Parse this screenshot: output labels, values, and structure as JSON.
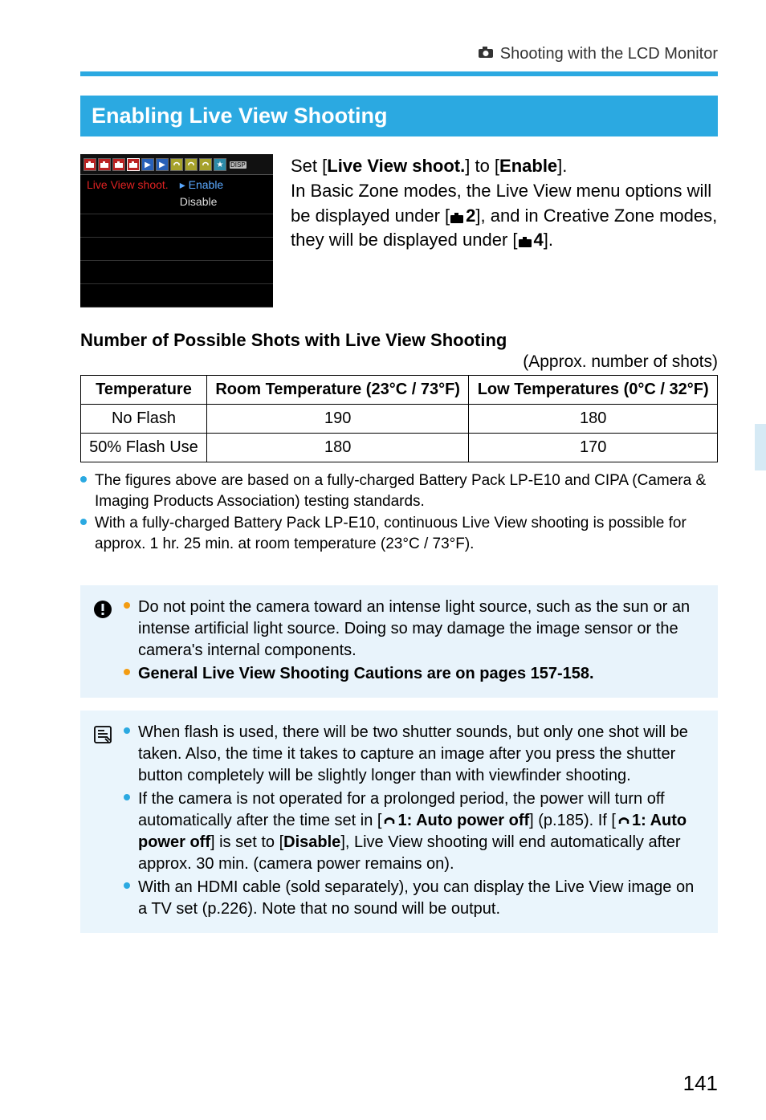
{
  "header": {
    "icon_name": "camera-icon",
    "text": "Shooting with the LCD Monitor"
  },
  "section_heading": "Enabling Live View Shooting",
  "screenshot": {
    "disp_label": "DISP",
    "menu_label": "Live View shoot.",
    "option_selected": "Enable",
    "option_other": "Disable"
  },
  "intro": {
    "l1a": "Set [",
    "l1b": "Live View shoot.",
    "l1c": "] to [",
    "l1d": "Enable",
    "l1e": "].",
    "l2": "In Basic Zone modes, the Live View menu options will be displayed under [",
    "tab2": "2",
    "l2b": "], and in Creative Zone modes, they will be displayed under [",
    "tab4": "4",
    "l2c": "]."
  },
  "subsection_heading": "Number of Possible Shots with Live View Shooting",
  "approx_note": "(Approx. number of shots)",
  "table": {
    "head": [
      "Temperature",
      "Room Temperature (23°C / 73°F)",
      "Low Temperatures (0°C / 32°F)"
    ],
    "rows": [
      [
        "No Flash",
        "190",
        "180"
      ],
      [
        "50% Flash Use",
        "180",
        "170"
      ]
    ]
  },
  "bullets_main": [
    "The figures above are based on a fully-charged Battery Pack LP-E10 and CIPA (Camera & Imaging Products Association) testing standards.",
    "With a fully-charged Battery Pack LP-E10, continuous Live View shooting is possible for approx. 1 hr. 25 min. at room temperature (23°C / 73°F)."
  ],
  "alert": {
    "bullets": [
      "Do not point the camera toward an intense light source, such as the sun or an intense artificial light source. Doing so may damage the image sensor or the camera's internal components."
    ],
    "bold_bullet": "General Live View Shooting Cautions are on pages 157-158."
  },
  "info": {
    "bullet1": "When flash is used, there will be two shutter sounds, but only one shot will be taken. Also, the time it takes to capture an image after you press the shutter button completely will be slightly longer than with viewfinder shooting.",
    "bullet2_a": "If the camera is not operated for a prolonged period, the power will turn off automatically after the time set in [",
    "bullet2_setting": "1: Auto power off",
    "bullet2_b": "] (p.185). If [",
    "bullet2_c": "] is set to [",
    "bullet2_disable": "Disable",
    "bullet2_d": "], Live View shooting will end automatically after approx. 30 min. (camera power remains on).",
    "bullet3": "With an HDMI cable (sold separately), you can display the Live View image on a TV set (p.226). Note that no sound will be output."
  },
  "page_number": "141"
}
